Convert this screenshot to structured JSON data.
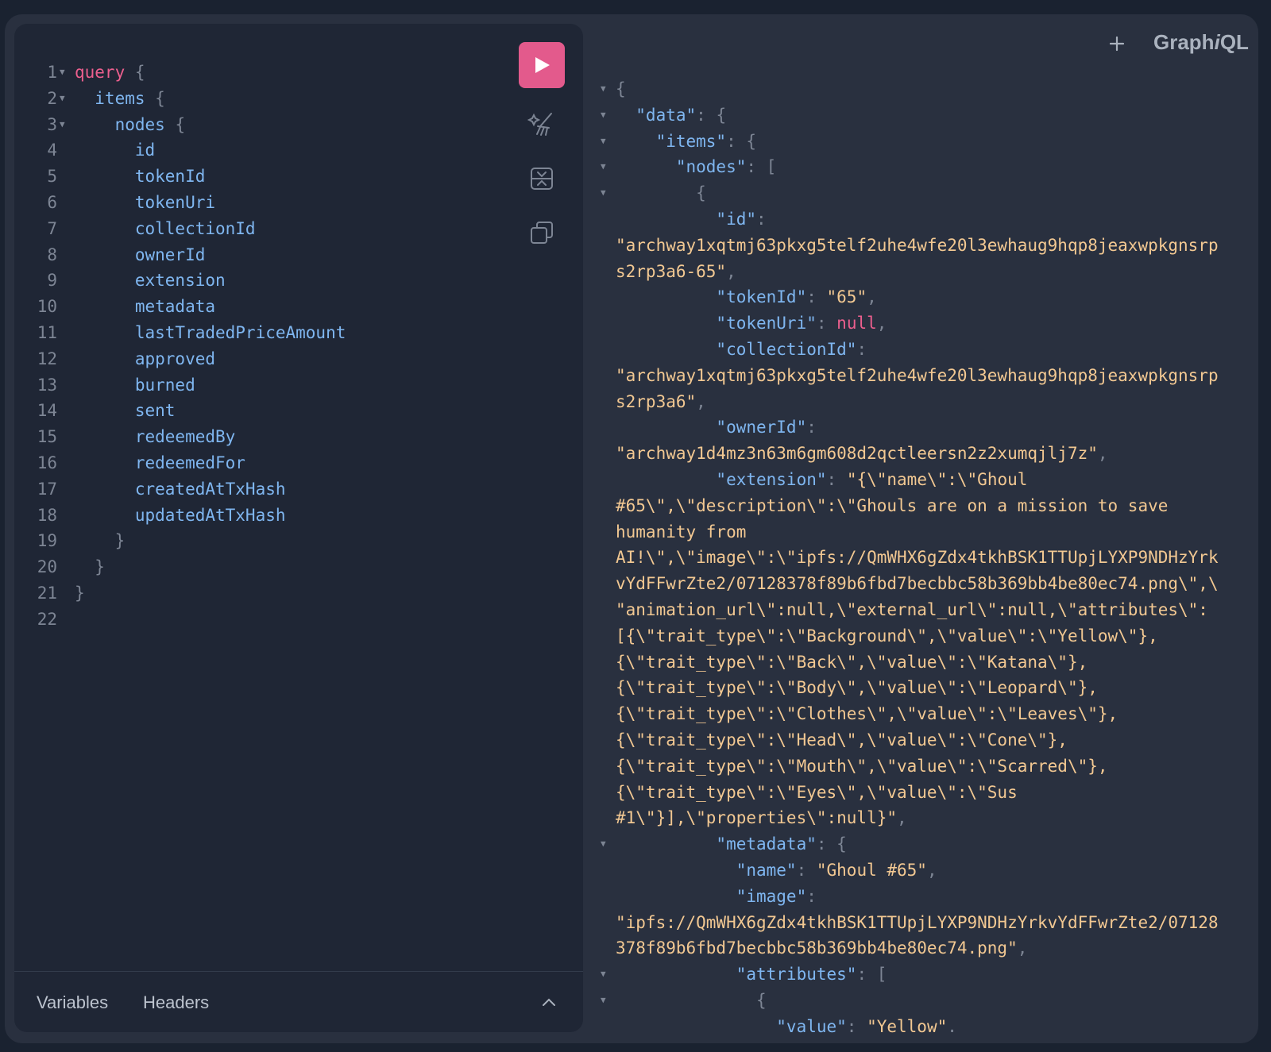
{
  "app": {
    "logo_prefix": "Graph",
    "logo_italic": "i",
    "logo_suffix": "QL"
  },
  "editor": {
    "lines": [
      [
        [
          "kw",
          "query"
        ],
        [
          "pn",
          " {"
        ]
      ],
      [
        [
          "fld",
          "  items"
        ],
        [
          "pn",
          " {"
        ]
      ],
      [
        [
          "fld",
          "    nodes"
        ],
        [
          "pn",
          " {"
        ]
      ],
      [
        [
          "fld",
          "      id"
        ]
      ],
      [
        [
          "fld",
          "      tokenId"
        ]
      ],
      [
        [
          "fld",
          "      tokenUri"
        ]
      ],
      [
        [
          "fld",
          "      collectionId"
        ]
      ],
      [
        [
          "fld",
          "      ownerId"
        ]
      ],
      [
        [
          "fld",
          "      extension"
        ]
      ],
      [
        [
          "fld",
          "      metadata"
        ]
      ],
      [
        [
          "fld",
          "      lastTradedPriceAmount"
        ]
      ],
      [
        [
          "fld",
          "      approved"
        ]
      ],
      [
        [
          "fld",
          "      burned"
        ]
      ],
      [
        [
          "fld",
          "      sent"
        ]
      ],
      [
        [
          "fld",
          "      redeemedBy"
        ]
      ],
      [
        [
          "fld",
          "      redeemedFor"
        ]
      ],
      [
        [
          "fld",
          "      createdAtTxHash"
        ]
      ],
      [
        [
          "fld",
          "      updatedAtTxHash"
        ]
      ],
      [
        [
          "pn",
          "    }"
        ]
      ],
      [
        [
          "pn",
          "  }"
        ]
      ],
      [
        [
          "pn",
          "}"
        ]
      ],
      []
    ],
    "foldable_lines": [
      1,
      2,
      3
    ]
  },
  "toolbar": {
    "run_icon": "play-icon",
    "prettify_icon": "magic-wand-icon",
    "merge_icon": "merge-fragments-icon",
    "copy_icon": "copy-icon"
  },
  "bottom": {
    "variables_label": "Variables",
    "headers_label": "Headers",
    "toggle_icon": "chevron-up-icon"
  },
  "header": {
    "add_tab_icon": "plus-icon"
  },
  "result": {
    "lines": [
      {
        "fold": true,
        "segs": [
          [
            "pn",
            "{"
          ]
        ]
      },
      {
        "fold": true,
        "segs": [
          [
            "key",
            "  \"data\""
          ],
          [
            "pn",
            ": {"
          ]
        ]
      },
      {
        "fold": true,
        "segs": [
          [
            "key",
            "    \"items\""
          ],
          [
            "pn",
            ": {"
          ]
        ]
      },
      {
        "fold": true,
        "segs": [
          [
            "key",
            "      \"nodes\""
          ],
          [
            "pn",
            ": ["
          ]
        ]
      },
      {
        "fold": true,
        "segs": [
          [
            "pn",
            "        {"
          ]
        ]
      },
      {
        "fold": false,
        "segs": [
          [
            "key",
            "          \"id\""
          ],
          [
            "pn",
            ":"
          ]
        ]
      },
      {
        "fold": false,
        "segs": [
          [
            "str",
            "\"archway1xqtmj63pkxg5telf2uhe4wfe20l3ewhaug9hqp8jeaxwpkgnsrp"
          ]
        ]
      },
      {
        "fold": false,
        "segs": [
          [
            "str",
            "s2rp3a6-65\""
          ],
          [
            "pn",
            ","
          ]
        ]
      },
      {
        "fold": false,
        "segs": [
          [
            "key",
            "          \"tokenId\""
          ],
          [
            "pn",
            ": "
          ],
          [
            "str",
            "\"65\""
          ],
          [
            "pn",
            ","
          ]
        ]
      },
      {
        "fold": false,
        "segs": [
          [
            "key",
            "          \"tokenUri\""
          ],
          [
            "pn",
            ": "
          ],
          [
            "nul",
            "null"
          ],
          [
            "pn",
            ","
          ]
        ]
      },
      {
        "fold": false,
        "segs": [
          [
            "key",
            "          \"collectionId\""
          ],
          [
            "pn",
            ":"
          ]
        ]
      },
      {
        "fold": false,
        "segs": [
          [
            "str",
            "\"archway1xqtmj63pkxg5telf2uhe4wfe20l3ewhaug9hqp8jeaxwpkgnsrp"
          ]
        ]
      },
      {
        "fold": false,
        "segs": [
          [
            "str",
            "s2rp3a6\""
          ],
          [
            "pn",
            ","
          ]
        ]
      },
      {
        "fold": false,
        "segs": [
          [
            "key",
            "          \"ownerId\""
          ],
          [
            "pn",
            ":"
          ]
        ]
      },
      {
        "fold": false,
        "segs": [
          [
            "str",
            "\"archway1d4mz3n63m6gm608d2qctleersn2z2xumqjlj7z\""
          ],
          [
            "pn",
            ","
          ]
        ]
      },
      {
        "fold": false,
        "segs": [
          [
            "key",
            "          \"extension\""
          ],
          [
            "pn",
            ": "
          ],
          [
            "str",
            "\"{\\\"name\\\":\\\"Ghoul"
          ]
        ]
      },
      {
        "fold": false,
        "segs": [
          [
            "str",
            "#65\\\",\\\"description\\\":\\\"Ghouls are on a mission to save"
          ]
        ]
      },
      {
        "fold": false,
        "segs": [
          [
            "str",
            "humanity from"
          ]
        ]
      },
      {
        "fold": false,
        "segs": [
          [
            "str",
            "AI!\\\",\\\"image\\\":\\\"ipfs://QmWHX6gZdx4tkhBSK1TTUpjLYXP9NDHzYrk"
          ]
        ]
      },
      {
        "fold": false,
        "segs": [
          [
            "str",
            "vYdFFwrZte2/07128378f89b6fbd7becbbc58b369bb4be80ec74.png\\\",\\"
          ]
        ]
      },
      {
        "fold": false,
        "segs": [
          [
            "str",
            "\"animation_url\\\":null,\\\"external_url\\\":null,\\\"attributes\\\":"
          ]
        ]
      },
      {
        "fold": false,
        "segs": [
          [
            "str",
            "[{\\\"trait_type\\\":\\\"Background\\\",\\\"value\\\":\\\"Yellow\\\"},"
          ]
        ]
      },
      {
        "fold": false,
        "segs": [
          [
            "str",
            "{\\\"trait_type\\\":\\\"Back\\\",\\\"value\\\":\\\"Katana\\\"},"
          ]
        ]
      },
      {
        "fold": false,
        "segs": [
          [
            "str",
            "{\\\"trait_type\\\":\\\"Body\\\",\\\"value\\\":\\\"Leopard\\\"},"
          ]
        ]
      },
      {
        "fold": false,
        "segs": [
          [
            "str",
            "{\\\"trait_type\\\":\\\"Clothes\\\",\\\"value\\\":\\\"Leaves\\\"},"
          ]
        ]
      },
      {
        "fold": false,
        "segs": [
          [
            "str",
            "{\\\"trait_type\\\":\\\"Head\\\",\\\"value\\\":\\\"Cone\\\"},"
          ]
        ]
      },
      {
        "fold": false,
        "segs": [
          [
            "str",
            "{\\\"trait_type\\\":\\\"Mouth\\\",\\\"value\\\":\\\"Scarred\\\"},"
          ]
        ]
      },
      {
        "fold": false,
        "segs": [
          [
            "str",
            "{\\\"trait_type\\\":\\\"Eyes\\\",\\\"value\\\":\\\"Sus"
          ]
        ]
      },
      {
        "fold": false,
        "segs": [
          [
            "str",
            "#1\\\"}],\\\"properties\\\":null}\""
          ],
          [
            "pn",
            ","
          ]
        ]
      },
      {
        "fold": true,
        "segs": [
          [
            "key",
            "          \"metadata\""
          ],
          [
            "pn",
            ": {"
          ]
        ]
      },
      {
        "fold": false,
        "segs": [
          [
            "key",
            "            \"name\""
          ],
          [
            "pn",
            ": "
          ],
          [
            "str",
            "\"Ghoul #65\""
          ],
          [
            "pn",
            ","
          ]
        ]
      },
      {
        "fold": false,
        "segs": [
          [
            "key",
            "            \"image\""
          ],
          [
            "pn",
            ":"
          ]
        ]
      },
      {
        "fold": false,
        "segs": [
          [
            "str",
            "\"ipfs://QmWHX6gZdx4tkhBSK1TTUpjLYXP9NDHzYrkvYdFFwrZte2/07128"
          ]
        ]
      },
      {
        "fold": false,
        "segs": [
          [
            "str",
            "378f89b6fbd7becbbc58b369bb4be80ec74.png\""
          ],
          [
            "pn",
            ","
          ]
        ]
      },
      {
        "fold": true,
        "segs": [
          [
            "key",
            "            \"attributes\""
          ],
          [
            "pn",
            ": ["
          ]
        ]
      },
      {
        "fold": true,
        "segs": [
          [
            "pn",
            "              {"
          ]
        ]
      },
      {
        "fold": false,
        "segs": [
          [
            "key",
            "                \"value\""
          ],
          [
            "pn",
            ": "
          ],
          [
            "str",
            "\"Yellow\""
          ],
          [
            "pn",
            "."
          ]
        ]
      }
    ]
  },
  "colors": {
    "accent": "#e35a8c",
    "keyword": "#ec5f8e",
    "field": "#7fb6f0",
    "string": "#f2c892",
    "punct": "#7d8594"
  }
}
